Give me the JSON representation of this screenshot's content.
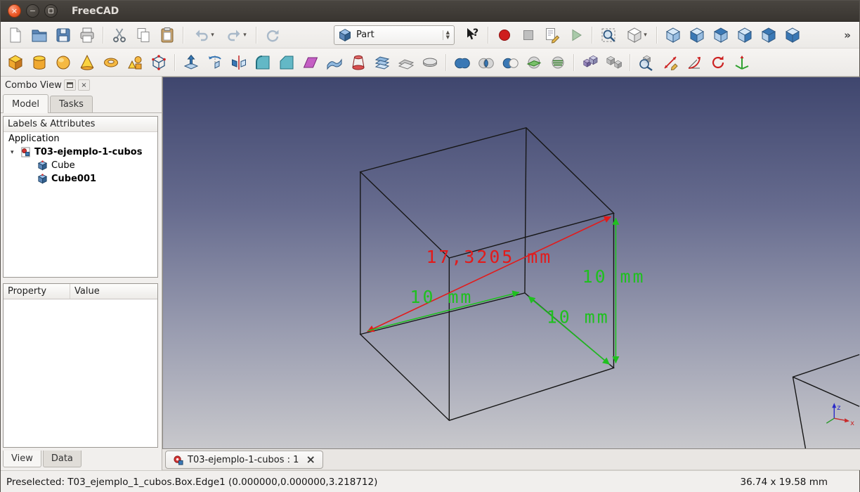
{
  "window": {
    "title": "FreeCAD",
    "controls": {
      "close": "×",
      "minimize": "−"
    }
  },
  "icons": {
    "close": "×",
    "expander": "▾",
    "caret_down": "▾",
    "spinner_up": "▲",
    "spinner_down": "▼"
  },
  "toolbar_main": {
    "file_group": [
      {
        "name": "new-document",
        "shape": "page"
      },
      {
        "name": "open-document",
        "shape": "folder"
      },
      {
        "name": "save-document",
        "shape": "save"
      },
      {
        "name": "print",
        "shape": "print"
      }
    ],
    "edit_group": [
      {
        "name": "cut",
        "shape": "cut"
      },
      {
        "name": "copy",
        "shape": "copy"
      },
      {
        "name": "paste",
        "shape": "paste"
      }
    ],
    "undo_group": [
      {
        "name": "undo",
        "shape": "undo",
        "caret": true
      },
      {
        "name": "redo",
        "shape": "redo",
        "caret": true
      }
    ],
    "refresh_group": [
      {
        "name": "refresh",
        "shape": "refresh"
      }
    ],
    "workbench_combo": {
      "label": "Part",
      "icon": "workbench-cube"
    },
    "help_group": [
      {
        "name": "whats-this",
        "shape": "whatsthis"
      }
    ],
    "macro_group": [
      {
        "name": "macro-record",
        "shape": "record"
      },
      {
        "name": "macro-stop",
        "shape": "stop"
      },
      {
        "name": "macro-edit",
        "shape": "macroedit"
      },
      {
        "name": "macro-execute",
        "shape": "play"
      }
    ],
    "view_group1": [
      {
        "name": "fit-all",
        "shape": "zoomfit"
      },
      {
        "name": "draw-style",
        "shape": "drawstyle",
        "caret": true
      }
    ],
    "view_group2": [
      {
        "name": "view-axonometric",
        "shape": "cube-axo"
      },
      {
        "name": "view-front",
        "shape": "cube-front"
      },
      {
        "name": "view-top",
        "shape": "cube-top"
      },
      {
        "name": "view-right",
        "shape": "cube-right"
      },
      {
        "name": "view-rear",
        "shape": "cube-rear"
      },
      {
        "name": "view-bottom",
        "shape": "cube-bottom"
      }
    ],
    "overflow": "»"
  },
  "toolbar_part": {
    "primitives_group": [
      {
        "name": "part-box",
        "shape": "pbox"
      },
      {
        "name": "part-cylinder",
        "shape": "pcylinder"
      },
      {
        "name": "part-sphere",
        "shape": "psphere"
      },
      {
        "name": "part-cone",
        "shape": "pcone"
      },
      {
        "name": "part-torus",
        "shape": "ptorus"
      },
      {
        "name": "create-primitives",
        "shape": "primitives"
      },
      {
        "name": "shape-builder",
        "shape": "shapebuilder"
      }
    ],
    "modify_group": [
      {
        "name": "extrude",
        "shape": "extrude"
      },
      {
        "name": "revolve",
        "shape": "revolve"
      },
      {
        "name": "mirror",
        "shape": "mirror"
      },
      {
        "name": "fillet",
        "shape": "fillet"
      },
      {
        "name": "chamfer",
        "shape": "chamfer"
      },
      {
        "name": "make-face",
        "shape": "makeface"
      },
      {
        "name": "ruled-surface",
        "shape": "ruled"
      },
      {
        "name": "loft",
        "shape": "loft"
      },
      {
        "name": "sweep",
        "shape": "sweep"
      },
      {
        "name": "offset",
        "shape": "offset"
      },
      {
        "name": "thickness",
        "shape": "thickness"
      }
    ],
    "boolean_group": [
      {
        "name": "boolean-union",
        "shape": "union"
      },
      {
        "name": "boolean-common",
        "shape": "common"
      },
      {
        "name": "boolean-cut",
        "shape": "cutb"
      },
      {
        "name": "section",
        "shape": "section"
      },
      {
        "name": "cross-sections",
        "shape": "xsections"
      }
    ],
    "compound_group": [
      {
        "name": "make-compound",
        "shape": "compound"
      },
      {
        "name": "explode-compound",
        "shape": "explode"
      }
    ],
    "measure_group": [
      {
        "name": "check-geometry",
        "shape": "checkgeom"
      },
      {
        "name": "measure-linear",
        "shape": "mlinear"
      },
      {
        "name": "measure-angular",
        "shape": "mangular"
      },
      {
        "name": "measure-refresh",
        "shape": "mrefresh"
      },
      {
        "name": "measure-toggle",
        "shape": "mtoggle"
      }
    ]
  },
  "combo_view": {
    "title": "Combo View",
    "tabs": [
      "Model",
      "Tasks"
    ],
    "tree_header": "Labels & Attributes",
    "tree": {
      "root": "Application",
      "document": "T03-ejemplo-1-cubos",
      "children": [
        "Cube",
        "Cube001"
      ]
    },
    "property_table": {
      "columns": [
        "Property",
        "Value"
      ]
    },
    "bottom_tabs": [
      "View",
      "Data"
    ]
  },
  "viewport": {
    "dimensions": {
      "diagonal": "17,3205 mm",
      "edge_bottom_left": "10 mm",
      "edge_right": "10 mm",
      "edge_bottom_right": "10 mm"
    },
    "axis_labels": {
      "x": "x",
      "z": "z"
    }
  },
  "document_tab": {
    "label": "T03-ejemplo-1-cubos : 1",
    "close": "×"
  },
  "status_bar": {
    "message": "Preselected: T03_ejemplo_1_cubos.Box.Edge1 (0.000000,0.000000,3.218712)",
    "dimension": "36.74 x 19.58 mm"
  }
}
